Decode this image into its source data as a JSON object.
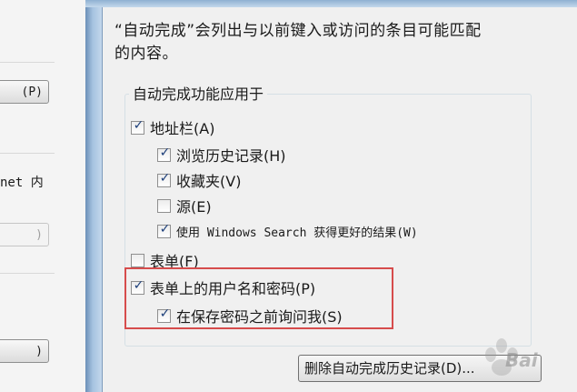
{
  "background_window": {
    "button1_label": "(P)",
    "text_line": "net 内",
    "button2_label": ")",
    "button3_label": ")"
  },
  "dialog": {
    "intro_line1": "“自动完成”会列出与以前键入或访问的条目可能匹配",
    "intro_line2": "的内容。",
    "group_title": "自动完成功能应用于",
    "options": [
      {
        "label": "地址栏(A)",
        "checked": true
      },
      {
        "label": "浏览历史记录(H)",
        "checked": true
      },
      {
        "label": "收藏夹(V)",
        "checked": true
      },
      {
        "label": "源(E)",
        "checked": false
      },
      {
        "label": "使用 Windows Search 获得更好的结果(W)",
        "checked": true
      },
      {
        "label": "表单(F)",
        "checked": false
      },
      {
        "label": "表单上的用户名和密码(P)",
        "checked": true
      },
      {
        "label": "在保存密码之前询问我(S)",
        "checked": true
      }
    ],
    "delete_button_label": "删除自动完成历史记录(D)..."
  },
  "watermark": {
    "text": "Bai"
  },
  "colors": {
    "highlight_border": "#d64c4c",
    "check_color": "#1d3f7a",
    "frame_blue": "#a6c3e0"
  }
}
